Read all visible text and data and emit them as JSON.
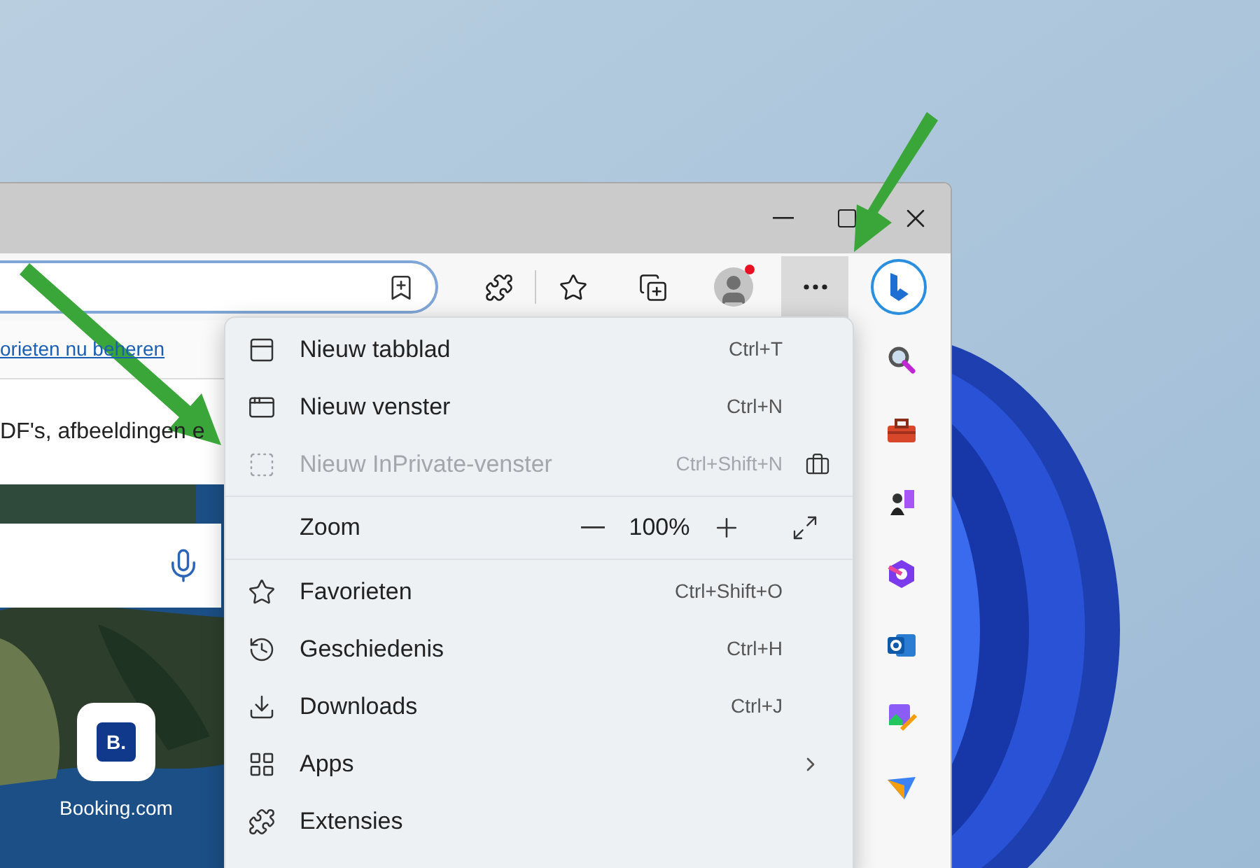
{
  "info_bar": {
    "link": "orieten nu beheren"
  },
  "page": {
    "text": "DF's, afbeeldingen e",
    "quick_links": [
      {
        "tile": "B.",
        "label": "Booking.com"
      }
    ]
  },
  "menu": {
    "items": [
      {
        "kind": "item",
        "label": "Nieuw tabblad",
        "shortcut": "Ctrl+T",
        "disabled": false
      },
      {
        "kind": "item",
        "label": "Nieuw venster",
        "shortcut": "Ctrl+N",
        "disabled": false
      },
      {
        "kind": "item",
        "label": "Nieuw InPrivate-venster",
        "shortcut": "Ctrl+Shift+N",
        "disabled": true,
        "badge": true
      },
      {
        "kind": "zoom",
        "label": "Zoom",
        "value": "100%"
      },
      {
        "kind": "item",
        "label": "Favorieten",
        "shortcut": "Ctrl+Shift+O",
        "disabled": false
      },
      {
        "kind": "item",
        "label": "Geschiedenis",
        "shortcut": "Ctrl+H",
        "disabled": false
      },
      {
        "kind": "item",
        "label": "Downloads",
        "shortcut": "Ctrl+J",
        "disabled": false
      },
      {
        "kind": "submenu",
        "label": "Apps",
        "disabled": false
      },
      {
        "kind": "item",
        "label": "Extensies",
        "disabled": false
      }
    ]
  }
}
